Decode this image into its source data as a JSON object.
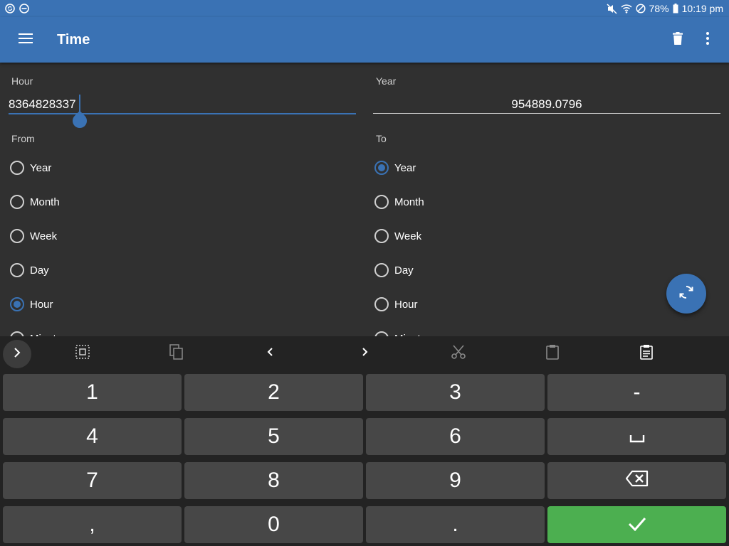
{
  "status_bar": {
    "battery": "78%",
    "time": "10:19 pm",
    "left_icons": [
      "sync-icon",
      "dnd-icon"
    ],
    "right_icons": [
      "mute-icon",
      "wifi-icon",
      "blocked-icon",
      "battery-icon"
    ]
  },
  "app_bar": {
    "title": "Time",
    "color": "#3a72b4"
  },
  "input_field": {
    "label": "Hour",
    "value": "8364828337"
  },
  "output_field": {
    "label": "Year",
    "value": "954889.0796"
  },
  "from": {
    "label": "From",
    "options": [
      "Year",
      "Month",
      "Week",
      "Day",
      "Hour",
      "Minute"
    ],
    "selected": "Hour"
  },
  "to": {
    "label": "To",
    "options": [
      "Year",
      "Month",
      "Week",
      "Day",
      "Hour",
      "Minute"
    ],
    "selected": "Year"
  },
  "keyboard": {
    "toolbar_icons": [
      "expand-icon",
      "select-all-icon",
      "copy-icon",
      "cursor-left-icon",
      "cursor-right-icon",
      "cut-icon",
      "paste-icon",
      "clipboard-icon"
    ],
    "rows": [
      [
        "1",
        "2",
        "3",
        "-"
      ],
      [
        "4",
        "5",
        "6",
        "␣"
      ],
      [
        "7",
        "8",
        "9",
        "⌫"
      ],
      [
        ",",
        "0",
        ".",
        "✓"
      ]
    ],
    "enter_color": "#4caf50"
  }
}
